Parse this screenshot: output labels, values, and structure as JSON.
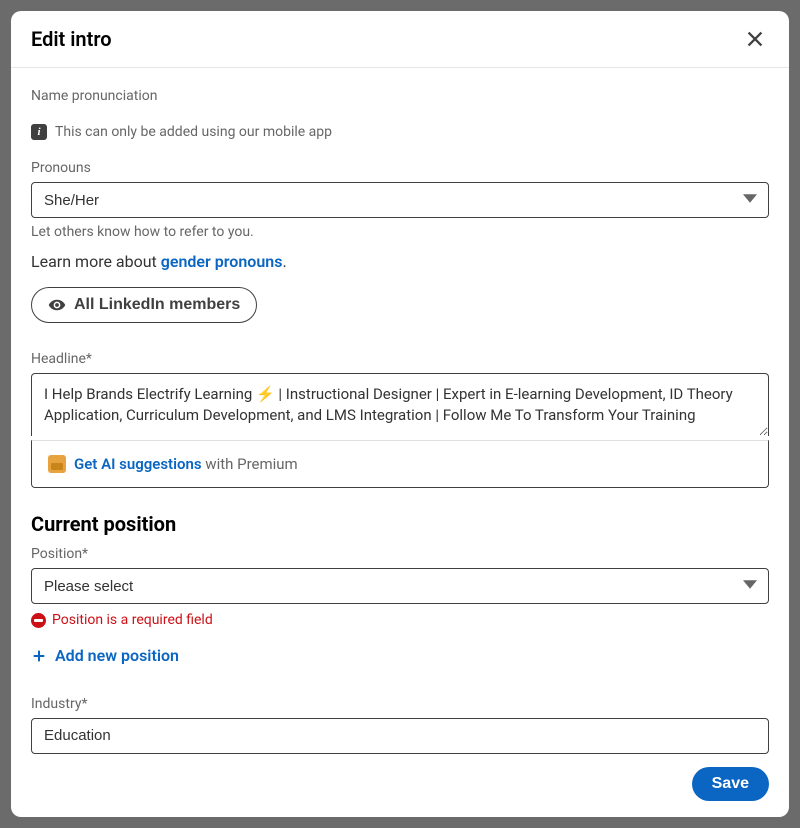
{
  "modal": {
    "title": "Edit intro"
  },
  "name_pronunciation": {
    "label": "Name pronunciation",
    "info_text": "This can only be added using our mobile app"
  },
  "pronouns": {
    "label": "Pronouns",
    "value": "She/Her",
    "helper": "Let others know how to refer to you.",
    "learn_more_prefix": "Learn more about ",
    "learn_more_link": "gender pronouns",
    "learn_more_suffix": "."
  },
  "visibility": {
    "label": "All LinkedIn members"
  },
  "headline": {
    "label": "Headline*",
    "value": "I Help Brands Electrify Learning ⚡ | Instructional Designer | Expert in E-learning Development, ID Theory Application, Curriculum Development, and LMS Integration | Follow Me To Transform Your Training",
    "ai_link": "Get AI suggestions",
    "ai_rest": " with Premium"
  },
  "current_position": {
    "section_title": "Current position",
    "label": "Position*",
    "value": "Please select",
    "error": "Position is a required field",
    "add_label": "Add new position"
  },
  "industry": {
    "label": "Industry*",
    "value": "Education"
  },
  "footer": {
    "save": "Save"
  }
}
